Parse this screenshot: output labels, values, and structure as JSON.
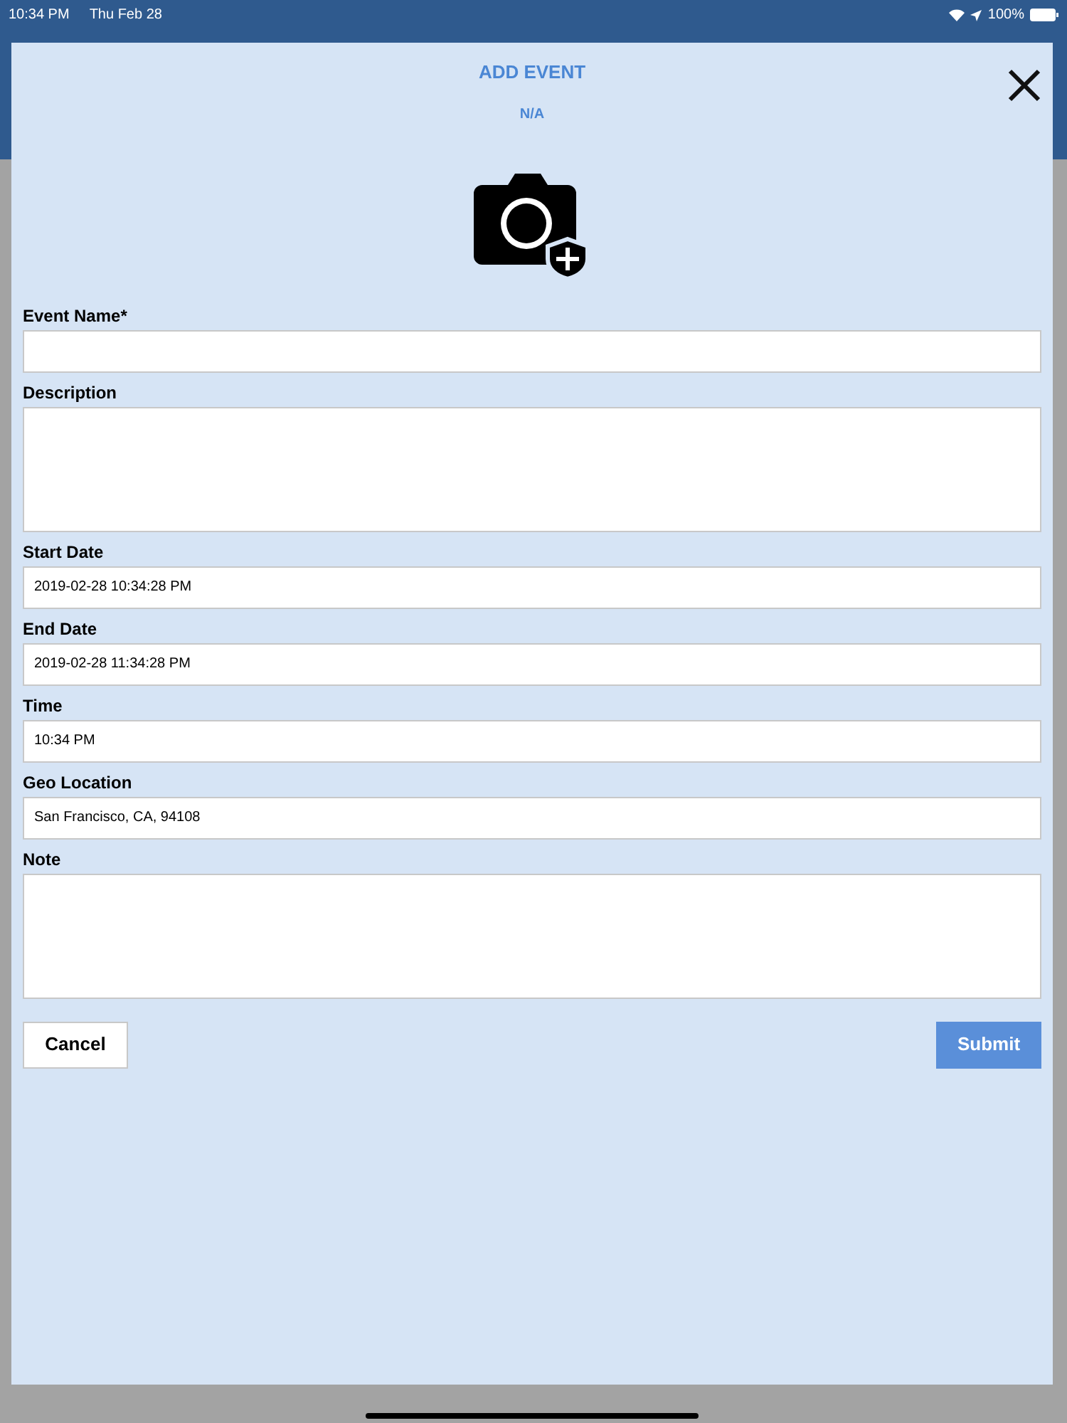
{
  "status_bar": {
    "time": "10:34 PM",
    "date": "Thu Feb 28",
    "battery": "100%"
  },
  "dialog": {
    "title": "ADD EVENT",
    "subtitle": "N/A"
  },
  "fields": [
    {
      "label": "Event Name*",
      "kind": "line"
    },
    {
      "label": "Description",
      "kind": "area"
    },
    {
      "label": "Start Date",
      "kind": "line",
      "value": "2019-02-28 10:34:28 PM"
    },
    {
      "label": "End Date",
      "kind": "line",
      "value": "2019-02-28 11:34:28 PM"
    },
    {
      "label": "Time",
      "kind": "line",
      "value": "10:34 PM"
    },
    {
      "label": "Geo Location",
      "kind": "line",
      "value": "San Francisco, CA, 94108"
    },
    {
      "label": "Note",
      "kind": "area"
    }
  ],
  "buttons": {
    "cancel": "Cancel",
    "submit": "Submit"
  }
}
